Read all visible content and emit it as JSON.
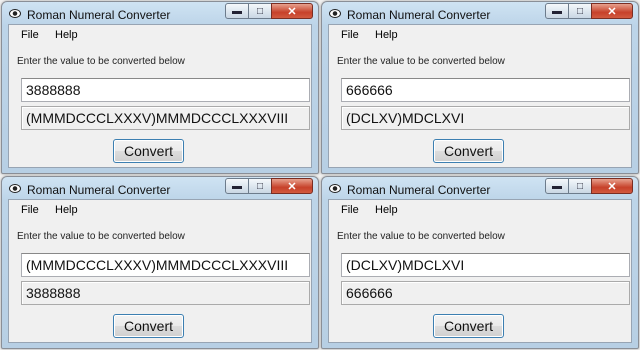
{
  "windows": [
    {
      "title": "Roman Numeral Converter",
      "menu": [
        "File",
        "Help"
      ],
      "prompt": "Enter the value to be converted below",
      "input_value": "3888888",
      "output_value": "(MMMDCCCLXXXV)MMMDCCCLXXXVIII",
      "convert_label": "Convert"
    },
    {
      "title": "Roman Numeral Converter",
      "menu": [
        "File",
        "Help"
      ],
      "prompt": "Enter the value to be converted below",
      "input_value": "666666",
      "output_value": "(DCLXV)MDCLXVI",
      "convert_label": "Convert"
    },
    {
      "title": "Roman Numeral Converter",
      "menu": [
        "File",
        "Help"
      ],
      "prompt": "Enter the value to be converted below",
      "input_value": "(MMMDCCCLXXXV)MMMDCCCLXXXVIII",
      "output_value": "3888888",
      "convert_label": "Convert"
    },
    {
      "title": "Roman Numeral Converter",
      "menu": [
        "File",
        "Help"
      ],
      "prompt": "Enter the value to be converted below",
      "input_value": "(DCLXV)MDCLXVI",
      "output_value": "666666",
      "convert_label": "Convert"
    }
  ],
  "caption_buttons": {
    "minimize": "minimize-icon",
    "maximize": "maximize-icon",
    "close": "close-icon"
  },
  "colors": {
    "title_bar": "#c4dbef",
    "close_button": "#c7412a",
    "button_border": "#3c7fb1"
  }
}
